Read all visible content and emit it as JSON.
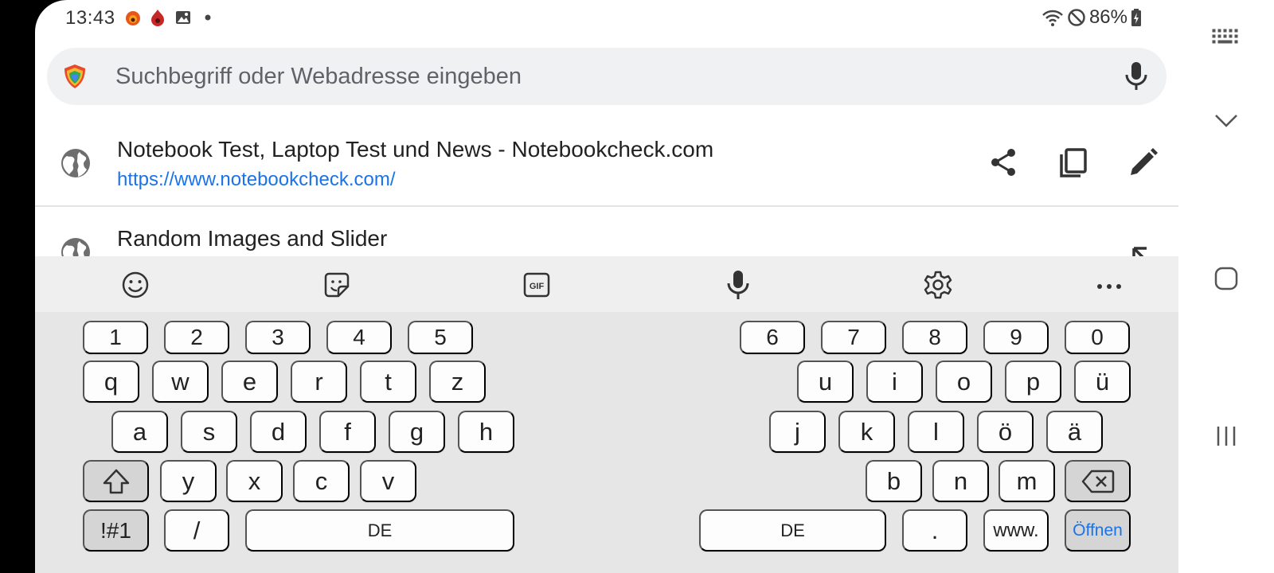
{
  "status_bar": {
    "time": "13:43",
    "battery": "86%"
  },
  "url_bar": {
    "placeholder": "Suchbegriff oder Webadresse eingeben"
  },
  "suggestions": [
    {
      "title": "Notebook Test, Laptop Test und News - Notebookcheck.com",
      "url": "https://www.notebookcheck.com/"
    },
    {
      "title": "Random Images and Slider"
    }
  ],
  "keyboard": {
    "numbers_left": [
      "1",
      "2",
      "3",
      "4",
      "5"
    ],
    "numbers_right": [
      "6",
      "7",
      "8",
      "9",
      "0"
    ],
    "row1_left": [
      "q",
      "w",
      "e",
      "r",
      "t",
      "z"
    ],
    "row1_right": [
      "u",
      "i",
      "o",
      "p",
      "ü"
    ],
    "row2_left": [
      "a",
      "s",
      "d",
      "f",
      "g",
      "h"
    ],
    "row2_right": [
      "j",
      "k",
      "l",
      "ö",
      "ä"
    ],
    "row3_left": [
      "y",
      "x",
      "c",
      "v"
    ],
    "row3_right": [
      "b",
      "n",
      "m"
    ],
    "symbols_label": "!#1",
    "slash_label": "/",
    "space_left_label": "DE",
    "space_right_label": "DE",
    "period_label": ".",
    "www_label": "www.",
    "enter_label": "Öffnen",
    "gif_label": "GIF"
  }
}
